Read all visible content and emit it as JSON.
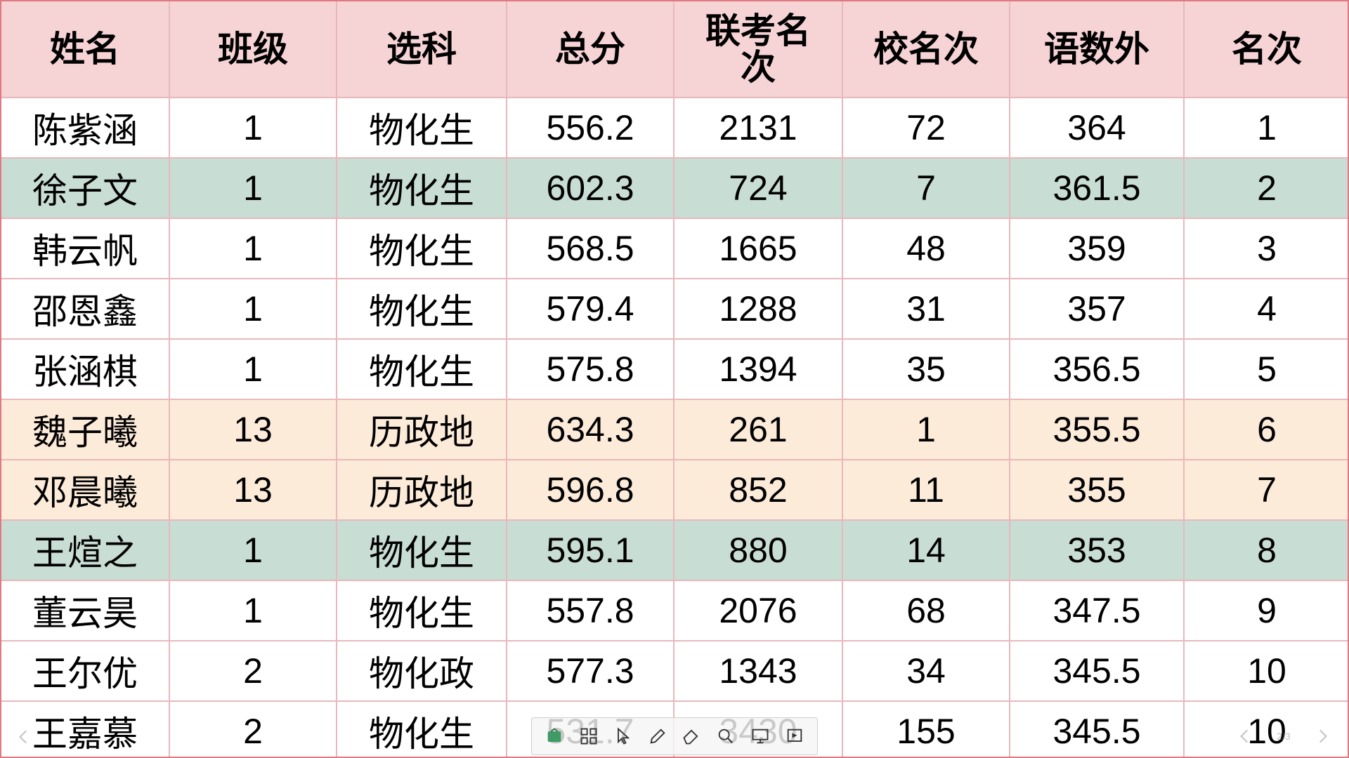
{
  "table": {
    "headers": [
      "姓名",
      "班级",
      "选科",
      "总分",
      "联考名次",
      "校名次",
      "语数外",
      "名次"
    ],
    "rows": [
      {
        "band": "white",
        "cells": [
          "陈紫涵",
          "1",
          "物化生",
          "556.2",
          "2131",
          "72",
          "364",
          "1"
        ]
      },
      {
        "band": "green",
        "cells": [
          "徐子文",
          "1",
          "物化生",
          "602.3",
          "724",
          "7",
          "361.5",
          "2"
        ]
      },
      {
        "band": "white",
        "cells": [
          "韩云帆",
          "1",
          "物化生",
          "568.5",
          "1665",
          "48",
          "359",
          "3"
        ]
      },
      {
        "band": "white",
        "cells": [
          "邵恩鑫",
          "1",
          "物化生",
          "579.4",
          "1288",
          "31",
          "357",
          "4"
        ]
      },
      {
        "band": "white",
        "cells": [
          "张涵棋",
          "1",
          "物化生",
          "575.8",
          "1394",
          "35",
          "356.5",
          "5"
        ]
      },
      {
        "band": "peach",
        "cells": [
          "魏子曦",
          "13",
          "历政地",
          "634.3",
          "261",
          "1",
          "355.5",
          "6"
        ]
      },
      {
        "band": "peach",
        "cells": [
          "邓晨曦",
          "13",
          "历政地",
          "596.8",
          "852",
          "11",
          "355",
          "7"
        ]
      },
      {
        "band": "green",
        "cells": [
          "王煊之",
          "1",
          "物化生",
          "595.1",
          "880",
          "14",
          "353",
          "8"
        ]
      },
      {
        "band": "white",
        "cells": [
          "董云昊",
          "1",
          "物化生",
          "557.8",
          "2076",
          "68",
          "347.5",
          "9"
        ]
      },
      {
        "band": "white",
        "cells": [
          "王尔优",
          "2",
          "物化政",
          "577.3",
          "1343",
          "34",
          "345.5",
          "10"
        ]
      },
      {
        "band": "white",
        "cells": [
          "王嘉慕",
          "2",
          "物化生",
          "531.7",
          "3430",
          "155",
          "345.5",
          "10"
        ]
      }
    ]
  },
  "colors": {
    "header_bg": "#f6d3d5",
    "band_green": "#c8ddd4",
    "band_peach": "#fdebd9",
    "grid": "#e8b8bc"
  },
  "toolbar": {
    "tools": [
      "slides-icon",
      "grid-icon",
      "pointer-icon",
      "pen-icon",
      "eraser-icon",
      "zoom-icon",
      "screen-icon",
      "present-icon"
    ]
  },
  "nav": {
    "right_page": "2/3"
  }
}
